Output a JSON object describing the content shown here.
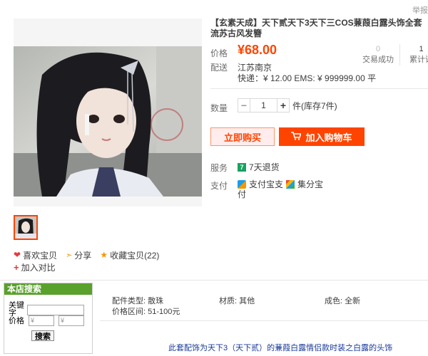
{
  "report": "举报",
  "product": {
    "title": "【玄素天成】天下贰天下3天下三COS蒹葭白露头饰全套流苏古风发簪",
    "price_label": "价格",
    "price": "¥68.00",
    "ship_label": "配送",
    "ship_city": "江苏南京",
    "ship_fee": "快递：¥ 12.00  EMS: ¥ 999999.00  平",
    "stats": [
      {
        "num": "0",
        "label": "交易成功"
      },
      {
        "num": "1",
        "label": "累计评"
      }
    ],
    "qty_label": "数量",
    "qty_minus": "−",
    "qty_value": "1",
    "qty_plus": "+",
    "qty_unit": "件(库存7件)",
    "buy_now": "立即购买",
    "add_cart": "加入购物车",
    "service_label": "服务",
    "service_badge": "7",
    "service_text": "7天退货",
    "pay_label": "支付",
    "pay_alipay": "支付宝支",
    "pay_alipay_2": "付",
    "pay_jifen": "集分宝"
  },
  "social": {
    "like": "喜欢宝贝",
    "share": "分享",
    "collect": "收藏宝贝(22)",
    "compare": "加入对比"
  },
  "shop_search": {
    "header": "本店搜索",
    "keyword_label": "关键",
    "keyword_label_2": "字",
    "price_label": "价格",
    "price_from_placeholder": "¥",
    "price_to_placeholder": "¥",
    "button": "搜索"
  },
  "attributes": {
    "rows": [
      [
        "配件类型: 散珠",
        "材质: 其他",
        "成色: 全新"
      ],
      [
        "价格区间: 51-100元",
        "",
        ""
      ]
    ]
  },
  "description": "此套配饰为天下3（天下贰）的蒹葭白露情侣款时装之白露的头饰",
  "colors": {
    "accent": "#ff4400",
    "shop_header": "#5aa02c",
    "link": "#1a3a99"
  }
}
